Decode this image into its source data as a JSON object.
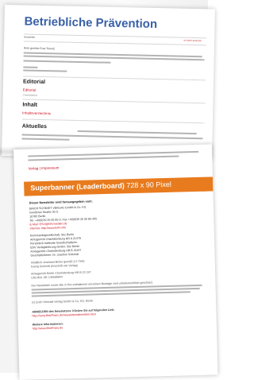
{
  "newsletter": {
    "title": "Betriebliche Prävention",
    "meta_left": "Newsletter",
    "meta_right": "Im Web ansehen",
    "salutation": "Sehr geehrte Frau Tümeli,",
    "sections": [
      {
        "heading": "Editorial",
        "link": "Editorial",
        "sub": "Chefredaktion"
      },
      {
        "heading": "Inhalt",
        "link": "Inhaltsverzeichnis",
        "sub": ""
      },
      {
        "heading": "Aktuelles",
        "link": "",
        "sub": ""
      }
    ]
  },
  "footer": {
    "impressum_link": "Verlag | Impressum",
    "leaderboard": {
      "label": "Superbanner (Leaderboard)",
      "size": "728 x 90 Pixel"
    },
    "imprint_heading": "Dieser Newsletter wird herausgegeben vom:",
    "publisher_lines": [
      "ERICH SCHMIDT VERLAG GmbH & Co. KG",
      "Genthiner Straße 30 G",
      "10785 Berlin",
      "Tel. +49(0)30 25 00 85-0, Fax +49(0)30 25 00 85-305",
      "E-Mail: ESV@ESVmedien.de",
      "Internet: http://www.ESV.info"
    ],
    "legal_lines": [
      "Kommanditgesellschaft, Sitz Berlin",
      "Amtsgericht Charlottenburg HR A 21378",
      "Persönlich haftende Gesellschafterin:",
      "ESV Verlagsführung GmbH, Sitz Berlin",
      "Amtsgericht Charlottenburg HR B 21197",
      "Geschäftsführer: Dr. Joachim Schmidt"
    ],
    "register_lines": [
      "Inhaltlich verantwortlicher gemäß § 5 TMG:",
      "Georg Schmidt (Anschrift wie Verlag)",
      "Amtsgericht Berlin Charlottenburg HR B 23 197",
      "USt.IdNr. DE 136668844"
    ],
    "disclaimer": "Der Newsletter sowie alle in ihm enthaltenen einzelnen Beiträge sind urheberrechtlich geschützt.",
    "copyright": "(c) Erich Schmidt Verlag GmbH & Co. KG, Berlin",
    "abmelden": "ABMELDEN des Newsletters: Klicken Sie auf folgenden Link:",
    "abmelden_link": "http://www.BetrPraev.de/newsletter/abmelden.html",
    "more_info": "Weitere Informationen:",
    "more_info_link": "http://www.BetrPraev.de"
  }
}
